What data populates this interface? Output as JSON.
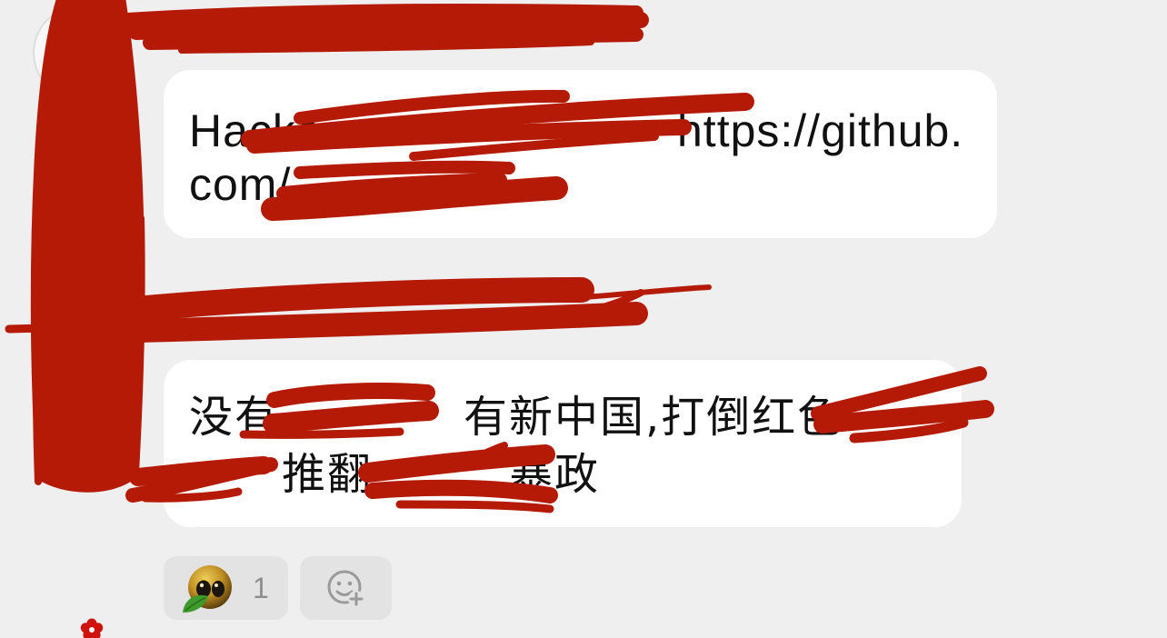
{
  "colors": {
    "background": "#efefef",
    "bubble": "#ffffff",
    "text": "#111111",
    "redaction": "#b41a06",
    "chip": "#e3e3e3",
    "muted": "#8e8e8e"
  },
  "sender": {
    "avatar_icon": "avatar"
  },
  "conversation": {
    "messages": [
      {
        "lines": [
          {
            "start": "Hacke",
            "link": "https://github."
          },
          {
            "start": "com/"
          }
        ]
      },
      {
        "lines": [
          {
            "start": "没有",
            "middle": "有新中国,打倒红色"
          },
          {
            "start": "推翻",
            "end": "暴政"
          }
        ]
      }
    ],
    "reactions": [
      {
        "icon": "emoji-face-icon",
        "count": "1"
      }
    ],
    "add_reaction": {
      "icon": "add-reaction-icon"
    }
  },
  "decorations": {
    "flower_icon": "red-flower-icon"
  }
}
